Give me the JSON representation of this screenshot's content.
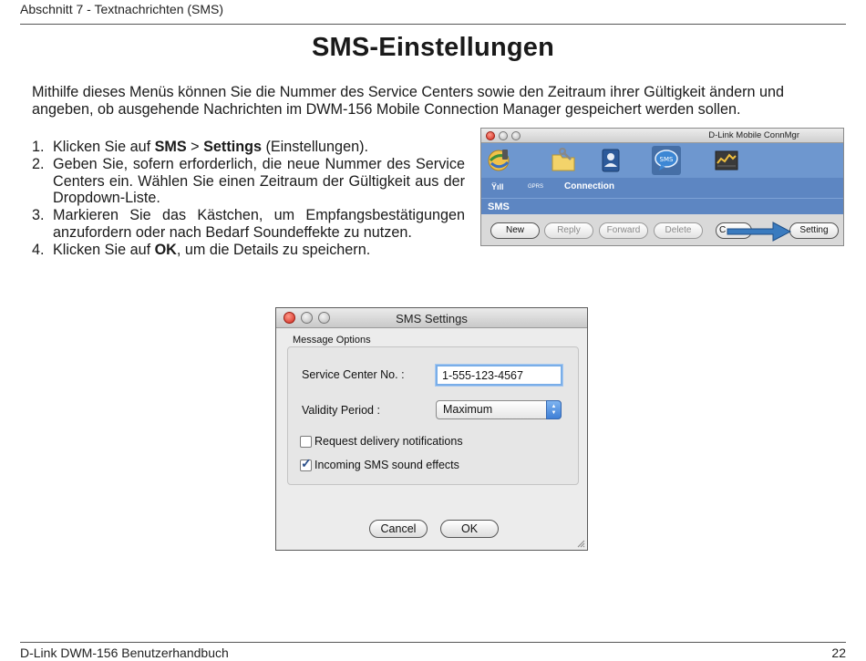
{
  "header": {
    "section": "Abschnitt 7 - Textnachrichten (SMS)"
  },
  "title": "SMS-Einstellungen",
  "intro": "Mithilfe dieses Menüs können Sie die Nummer des Service Centers sowie den Zeitraum ihrer Gültigkeit ändern und angeben, ob ausgehende Nachrichten im DWM-156 Mobile Connection Manager gespeichert werden sollen.",
  "steps": [
    {
      "num": "1.",
      "pre": "Klicken Sie auf ",
      "b1": "SMS",
      "mid": " > ",
      "b2": "Settings",
      "post": " (Einstellungen)."
    },
    {
      "num": "2.",
      "text": "Geben Sie, sofern erforderlich, die neue Nummer des Service Centers ein. Wählen Sie einen Zeitraum der Gültigkeit aus der Dropdown-Liste."
    },
    {
      "num": "3.",
      "text": "Markieren Sie das Kästchen, um Empfangsbestätigungen anzufordern oder nach Bedarf Soundeffekte zu nutzen."
    },
    {
      "num": "4.",
      "pre": "Klicken Sie auf ",
      "b1": "OK",
      "post": ", um die Details zu speichern."
    }
  ],
  "connmgr": {
    "window_title": "D-Link Mobile ConnMgr",
    "signal": "Ÿıll",
    "gprs": "GPRS",
    "connection_label": "Connection",
    "sms_label": "SMS",
    "sms_icon_text": "SMS",
    "buttons": {
      "new": "New",
      "reply": "Reply",
      "forward": "Forward",
      "delete": "Delete",
      "partial": "C",
      "setting": "Setting"
    },
    "arrow_color": "#3a7bbf"
  },
  "dialog": {
    "title": "SMS Settings",
    "group_label": "Message Options",
    "service_center_label": "Service Center No. :",
    "service_center_value": "1-555-123-4567",
    "validity_label": "Validity Period :",
    "validity_value": "Maximum",
    "delivery_label": "Request delivery notifications",
    "delivery_checked": false,
    "sound_label": "Incoming SMS sound effects",
    "sound_checked": true,
    "cancel": "Cancel",
    "ok": "OK"
  },
  "footer": {
    "left": "D-Link DWM-156 Benutzerhandbuch",
    "page": "22"
  }
}
